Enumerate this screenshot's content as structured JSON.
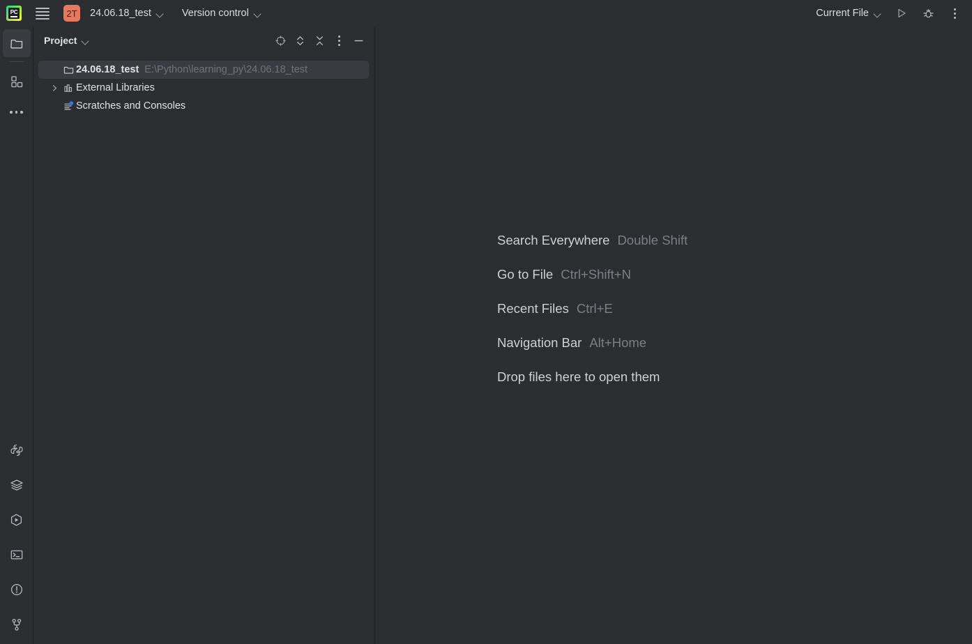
{
  "titlebar": {
    "logo_icon": "pycharm-logo",
    "logo_text": "PC",
    "menu_icon": "hamburger-menu-icon",
    "project_badge": "2T",
    "project_name": "24.06.18_test",
    "vcs_label": "Version control",
    "run_config_label": "Current File",
    "run_icon": "run-play-icon",
    "debug_icon": "debug-bug-icon",
    "more_icon": "more-vertical-icon",
    "badge_color": "#e5795e"
  },
  "rail": {
    "top_items": [
      {
        "name": "project-tool-window",
        "icon": "folder-icon",
        "selected": true
      },
      {
        "name": "structure-tool-window",
        "icon": "structure-squares-icon",
        "selected": false
      },
      {
        "name": "more-tool-windows",
        "icon": "ellipsis-icon",
        "selected": false
      }
    ],
    "bottom_items": [
      {
        "name": "python-console",
        "icon": "python-icon"
      },
      {
        "name": "database",
        "icon": "layers-icon"
      },
      {
        "name": "run-tool-window",
        "icon": "hexagon-play-icon"
      },
      {
        "name": "terminal-tool-window",
        "icon": "terminal-icon"
      },
      {
        "name": "problems-tool-window",
        "icon": "warning-circle-icon"
      },
      {
        "name": "version-control-tool-window",
        "icon": "git-branch-icon"
      }
    ]
  },
  "project_panel": {
    "title": "Project",
    "title_chevron_icon": "chevron-down-icon",
    "tools": [
      {
        "name": "select-opened-file-button",
        "icon": "crosshair-target-icon"
      },
      {
        "name": "expand-all-button",
        "icon": "expand-chevrons-icon"
      },
      {
        "name": "collapse-all-button",
        "icon": "collapse-chevrons-icon"
      },
      {
        "name": "options-button",
        "icon": "more-vertical-icon"
      },
      {
        "name": "hide-button",
        "icon": "minus-icon"
      }
    ],
    "tree": [
      {
        "name": "tree-item-project-root",
        "label": "24.06.18_test",
        "path": "E:\\Python\\learning_py\\24.06.18_test",
        "icon": "folder-icon",
        "arrow": "none",
        "selected": true,
        "bold": true
      },
      {
        "name": "tree-item-external-libraries",
        "label": "External Libraries",
        "path": "",
        "icon": "library-icon",
        "arrow": "chevron-right",
        "selected": false,
        "bold": false
      },
      {
        "name": "tree-item-scratches-and-consoles",
        "label": "Scratches and Consoles",
        "path": "",
        "icon": "scratches-icon",
        "arrow": "none",
        "selected": false,
        "bold": false
      }
    ]
  },
  "editor": {
    "hints": [
      {
        "action": "Search Everywhere",
        "key": "Double Shift"
      },
      {
        "action": "Go to File",
        "key": "Ctrl+Shift+N"
      },
      {
        "action": "Recent Files",
        "key": "Ctrl+E"
      },
      {
        "action": "Navigation Bar",
        "key": "Alt+Home"
      },
      {
        "action": "Drop files here to open them",
        "key": ""
      }
    ]
  }
}
